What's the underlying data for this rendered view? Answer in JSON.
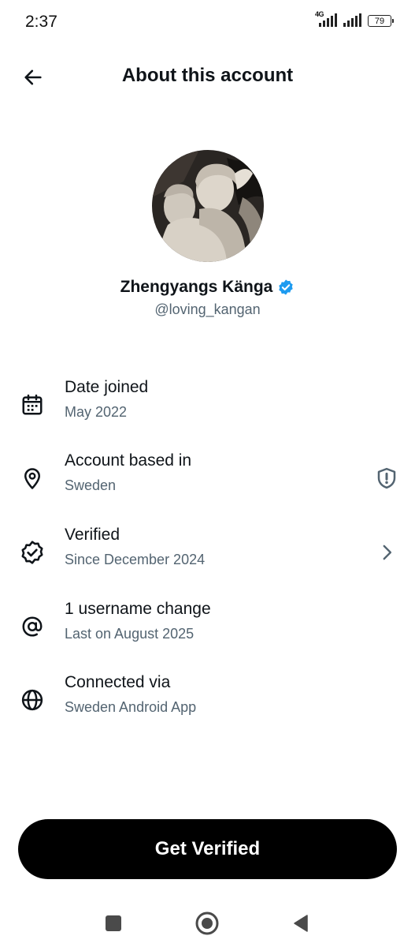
{
  "status_bar": {
    "time": "2:37",
    "network_label": "4G",
    "battery_level": "79",
    "icons": [
      "signal-4g-icon",
      "signal-icon",
      "battery-icon"
    ]
  },
  "header": {
    "title": "About this account",
    "back_icon": "arrow-left-icon"
  },
  "profile": {
    "display_name": "Zhengyangs Känga",
    "handle": "@loving_kangan",
    "verified": true,
    "verified_color": "#1d9bf0"
  },
  "details": [
    {
      "icon": "calendar-icon",
      "title": "Date joined",
      "subtitle": "May 2022"
    },
    {
      "icon": "location-pin-icon",
      "title": "Account based in",
      "subtitle": "Sweden",
      "trailing_icon": "shield-alert-icon"
    },
    {
      "icon": "verified-badge-icon",
      "title": "Verified",
      "subtitle": "Since December 2024",
      "trailing_icon": "chevron-right-icon"
    },
    {
      "icon": "at-sign-icon",
      "title": "1 username change",
      "subtitle": "Last on August 2025"
    },
    {
      "icon": "globe-icon",
      "title": "Connected via",
      "subtitle": "Sweden Android App"
    }
  ],
  "cta": {
    "label": "Get Verified"
  },
  "navigation_bar": {
    "buttons": [
      "recents-square-icon",
      "home-circle-icon",
      "back-triangle-icon"
    ]
  },
  "colors": {
    "text_primary": "#0f1419",
    "text_secondary": "#536471",
    "accent": "#1d9bf0",
    "button_bg": "#000000",
    "button_text": "#ffffff"
  }
}
